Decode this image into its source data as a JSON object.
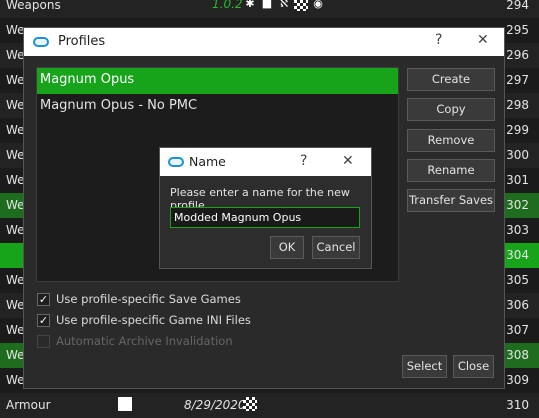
{
  "background_list": {
    "rows": [
      {
        "name": "Weapons",
        "num": "294",
        "version": "1.0.2",
        "style": "alt"
      },
      {
        "name": "We",
        "num": "295",
        "style": ""
      },
      {
        "name": "We",
        "num": "296",
        "style": "alt"
      },
      {
        "name": "We",
        "num": "297",
        "style": ""
      },
      {
        "name": "We",
        "num": "298",
        "style": "alt"
      },
      {
        "name": "We",
        "num": "299",
        "style": ""
      },
      {
        "name": "We",
        "num": "300",
        "style": "alt"
      },
      {
        "name": "We",
        "num": "301",
        "style": ""
      },
      {
        "name": "We",
        "num": "302",
        "style": "green"
      },
      {
        "name": "We",
        "num": "303",
        "style": ""
      },
      {
        "name": "",
        "num": "304",
        "style": "bright"
      },
      {
        "name": "We",
        "num": "305",
        "style": ""
      },
      {
        "name": "We",
        "num": "306",
        "style": "alt"
      },
      {
        "name": "We",
        "num": "307",
        "style": ""
      },
      {
        "name": "We",
        "num": "308",
        "style": "green"
      },
      {
        "name": "We",
        "num": "309",
        "style": ""
      },
      {
        "name": "Armour",
        "num": "310",
        "date": "8/29/2020",
        "style": "alt"
      }
    ]
  },
  "profiles_dialog": {
    "title": "Profiles",
    "help": "?",
    "close": "✕",
    "profiles": [
      "Magnum Opus",
      "Magnum Opus - No PMC"
    ],
    "buttons": {
      "create": "Create",
      "copy": "Copy",
      "remove": "Remove",
      "rename": "Rename",
      "transfer": "Transfer Saves",
      "select": "Select",
      "close": "Close"
    },
    "options": {
      "save_games": "Use profile-specific Save Games",
      "game_ini": "Use profile-specific Game INI Files",
      "archive": "Automatic Archive Invalidation"
    }
  },
  "name_dialog": {
    "title": "Name",
    "help": "?",
    "close": "✕",
    "prompt": "Please enter a name for the new profile",
    "value": "Modded Magnum Opus",
    "ok": "OK",
    "cancel": "Cancel"
  },
  "colors": {
    "accent": "#17a31a",
    "accent_dark": "#1e6d1e",
    "window_icon": "#1e90d6"
  }
}
